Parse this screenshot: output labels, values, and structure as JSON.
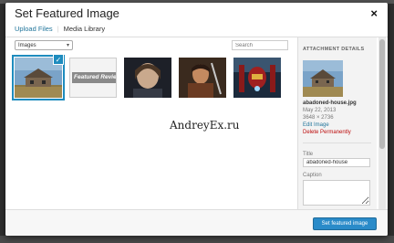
{
  "modal": {
    "title": "Set Featured Image",
    "close_label": "×"
  },
  "nav": {
    "upload_label": "Upload Files",
    "separator": "|",
    "library_label": "Media Library"
  },
  "toolbar": {
    "filter_value": "Images",
    "filter_chevron": "▾",
    "search_placeholder": "Search"
  },
  "grid": {
    "selected_check": "✓",
    "items": [
      {
        "icon": "abandoned-house-photo",
        "selected": true
      },
      {
        "icon": "featured-review-banner",
        "label": "Featured Review"
      },
      {
        "icon": "portrait-photo"
      },
      {
        "icon": "hobbit-photo"
      },
      {
        "icon": "iron-man-poster"
      }
    ]
  },
  "watermark": "AndreyEx.ru",
  "details": {
    "heading": "ATTACHMENT DETAILS",
    "filename": "abadoned-house.jpg",
    "date": "May 22, 2013",
    "dimensions": "3648 × 2736",
    "edit_label": "Edit Image",
    "delete_label": "Delete Permanently",
    "title_label": "Title",
    "title_value": "abadoned-house",
    "caption_label": "Caption"
  },
  "footer": {
    "button_label": "Set featured image"
  },
  "colors": {
    "accent": "#2a8bc9",
    "link": "#21759b",
    "danger": "#bc0b0b"
  }
}
